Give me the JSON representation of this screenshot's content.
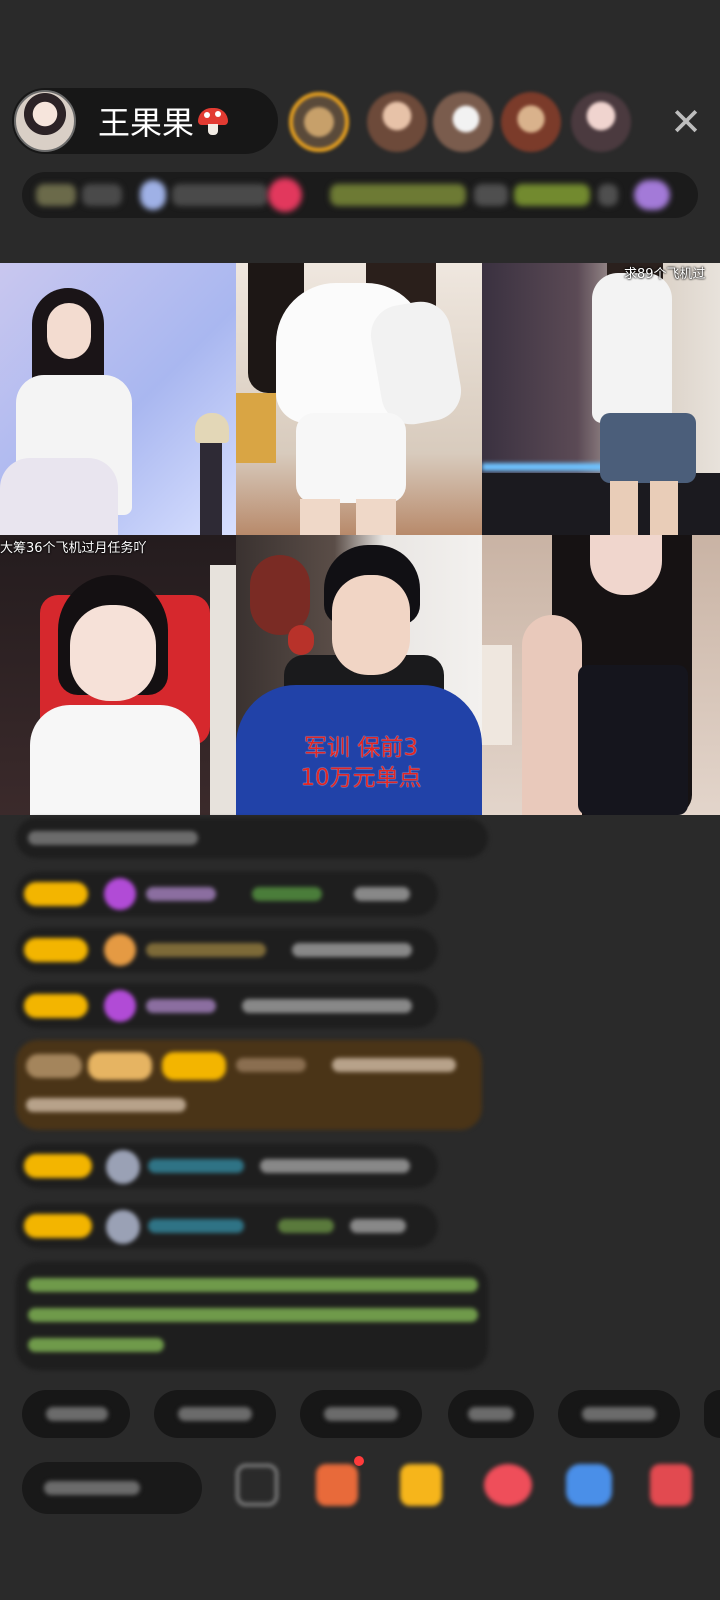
{
  "header": {
    "host_name": "王果果",
    "avatar": "host-avatar",
    "close_icon": "close-icon",
    "viewer_avatars": [
      "viewer-avatar-1",
      "viewer-avatar-2",
      "viewer-avatar-3",
      "viewer-avatar-4",
      "viewer-avatar-5",
      "viewer-avatar-6"
    ]
  },
  "grid": {
    "captions": {
      "tile3_top": "求89个飞机过",
      "tile4_top": "大筹36个飞机过月任务吖",
      "tile5_overlay_line1": "军训 保前3",
      "tile5_overlay_line2": "10万元单点"
    }
  },
  "colors": {
    "badge_gold": "#f3b500",
    "chat_bg": "#1e1e1e",
    "page_bg": "#2a2a2a",
    "overlay_red": "#e02626",
    "notice_green": "#8fd16a"
  }
}
